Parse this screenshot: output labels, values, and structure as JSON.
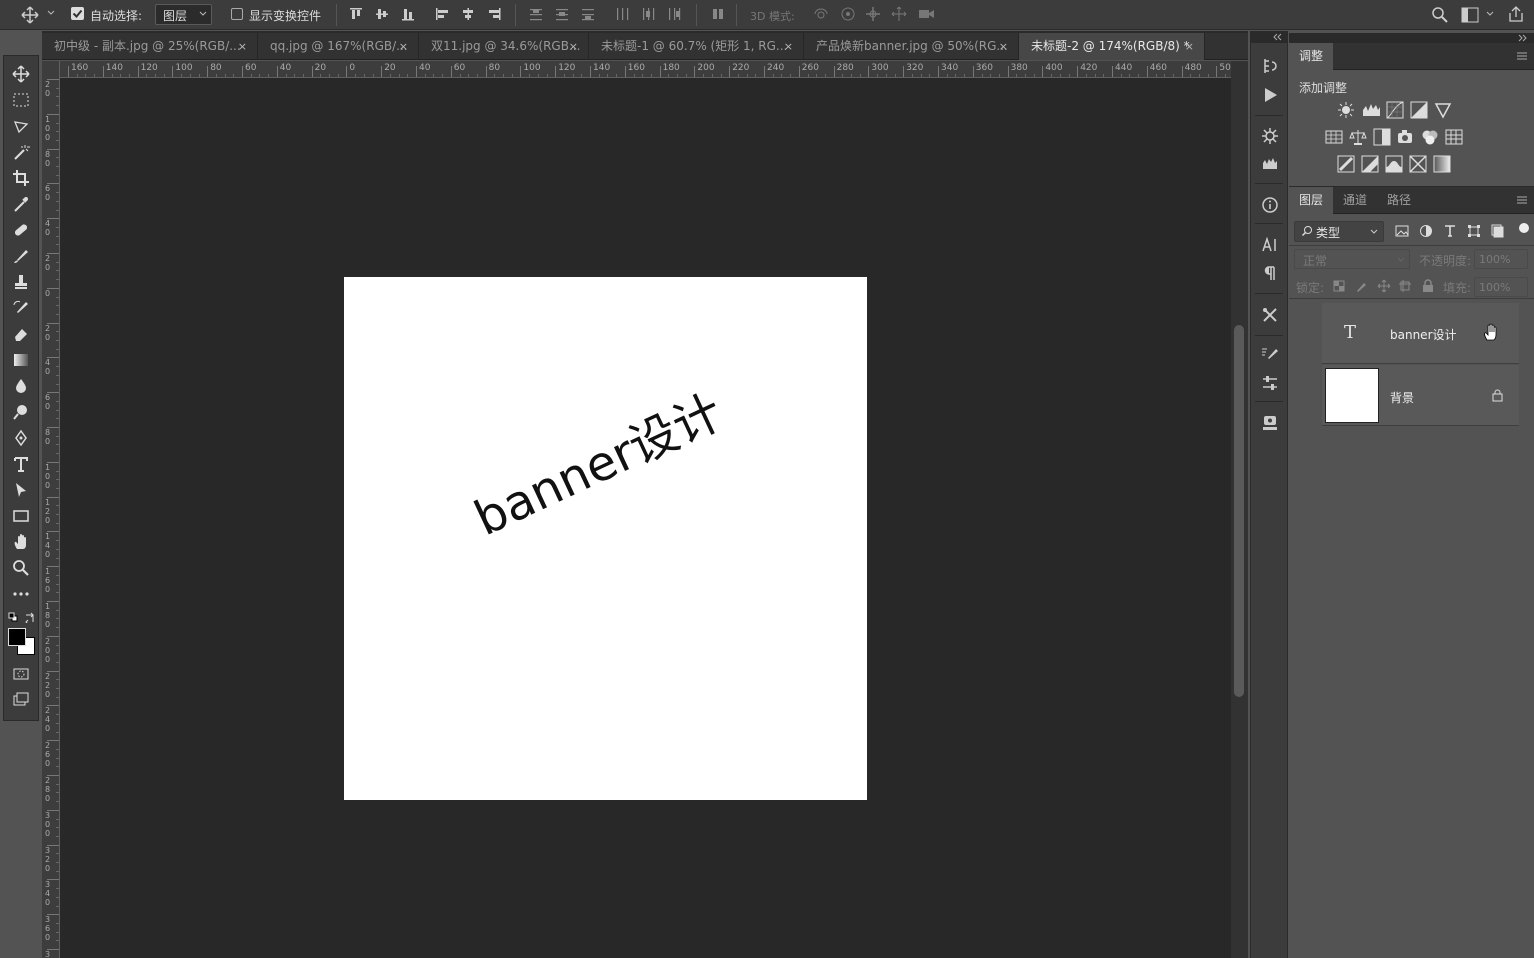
{
  "options_bar": {
    "auto_select_label": "自动选择:",
    "auto_select_value": "图层",
    "show_transform_label": "显示变换控件",
    "mode_3d_label": "3D 模式:"
  },
  "tabs": [
    {
      "label": "初中级 - 副本.jpg @ 25%(RGB/...",
      "close": "×"
    },
    {
      "label": "qq.jpg @ 167%(RGB/...",
      "close": "×"
    },
    {
      "label": "双11.jpg @ 34.6%(RGB...",
      "close": "×"
    },
    {
      "label": "未标题-1 @ 60.7% (矩形 1, RG...",
      "close": "×"
    },
    {
      "label": "产品焕新banner.jpg @ 50%(RG...",
      "close": "×"
    },
    {
      "label": "未标题-2 @ 174%(RGB/8) *",
      "close": "×"
    }
  ],
  "ruler": {
    "h_labels": [
      "160",
      "140",
      "120",
      "100",
      "80",
      "60",
      "40",
      "20",
      "0",
      "20",
      "40",
      "60",
      "80",
      "100",
      "120",
      "140",
      "160",
      "180",
      "200",
      "220",
      "240",
      "260",
      "280",
      "300",
      "320",
      "340",
      "360",
      "380",
      "400",
      "420",
      "440",
      "460",
      "480",
      "50"
    ],
    "v_labels": [
      "2\n0",
      "1\n0\n0",
      "8\n0",
      "6\n0",
      "4\n0",
      "2\n0",
      "0",
      "2\n0",
      "4\n0",
      "6\n0",
      "8\n0",
      "1\n0\n0",
      "1\n2\n0",
      "1\n4\n0",
      "1\n6\n0",
      "1\n8\n0",
      "2\n0\n0",
      "2\n2\n0",
      "2\n4\n0",
      "2\n6\n0",
      "2\n8\n0",
      "3\n0\n0",
      "3\n2\n0",
      "3\n4\n0",
      "3\n6\n0",
      "3\n8\n0"
    ]
  },
  "canvas": {
    "text": "banner设计",
    "background": "#ffffff",
    "text_color": "#111111",
    "rotation_deg": -25
  },
  "adjustments": {
    "tab": "调整",
    "add_label": "添加调整"
  },
  "layers_panel": {
    "tabs": [
      "图层",
      "通道",
      "路径"
    ],
    "filter_label": "类型",
    "blend_mode": "正常",
    "opacity_label": "不透明度:",
    "opacity_value": "100%",
    "lock_label": "锁定:",
    "fill_label": "填充:",
    "fill_value": "100%",
    "layers": [
      {
        "name": "banner设计",
        "type": "text",
        "thumb_glyph": "T"
      },
      {
        "name": "背景",
        "type": "background",
        "locked": true
      }
    ]
  },
  "colors": {
    "accent": "#cccccc",
    "foreground": "#000000",
    "background": "#ffffff"
  }
}
